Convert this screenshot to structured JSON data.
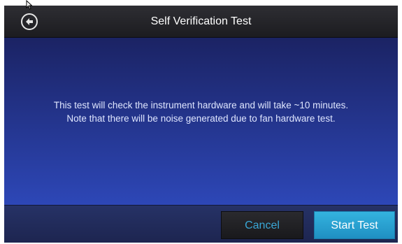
{
  "header": {
    "title": "Self Verification Test",
    "back_icon": "back-arrow-circle-icon"
  },
  "message": {
    "line1": "This test will check the instrument hardware and will take ~10 minutes.",
    "line2": "Note that there will be noise generated due to fan hardware test."
  },
  "footer": {
    "cancel_label": "Cancel",
    "start_label": "Start Test"
  },
  "colors": {
    "header_bg": "#2a2a2e",
    "content_bg_top": "#1b2364",
    "content_bg_bottom": "#2d47b7",
    "accent": "#2fa8db",
    "text": "#dfe6ff"
  }
}
